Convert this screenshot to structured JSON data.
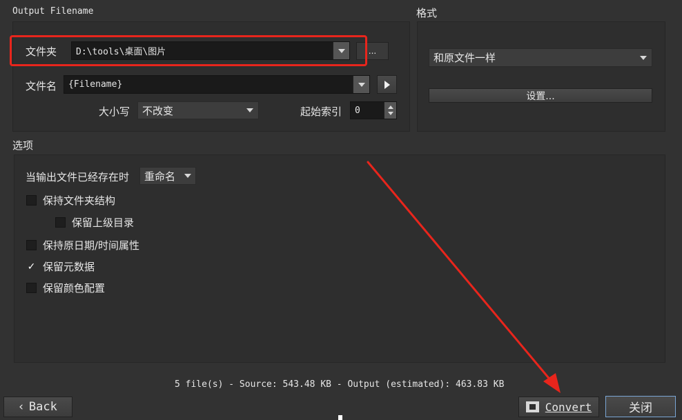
{
  "output": {
    "title": "Output Filename",
    "folder_label": "文件夹",
    "folder_value": "D:\\tools\\桌面\\图片",
    "browse_label": "...",
    "filename_label": "文件名",
    "filename_value": "{Filename}",
    "case_label": "大小写",
    "case_value": "不改变",
    "start_index_label": "起始索引",
    "start_index_value": "0"
  },
  "format": {
    "title": "格式",
    "format_value": "和原文件一样",
    "settings_label": "设置..."
  },
  "options": {
    "title": "选项",
    "exists_label": "当输出文件已经存在时",
    "exists_value": "重命名",
    "checkboxes": [
      {
        "label": "保持文件夹结构",
        "checked": false
      },
      {
        "label": "保留上级目录",
        "checked": false
      },
      {
        "label": "保持原日期/时间属性",
        "checked": false
      },
      {
        "label": "保留元数据",
        "checked": true
      },
      {
        "label": "保留颜色配置",
        "checked": false
      }
    ]
  },
  "status": {
    "text": "5 file(s) - Source: 543.48 KB - Output (estimated): 463.83 KB"
  },
  "footer": {
    "back_label": "Back",
    "convert_label": "Convert",
    "close_label": "关闭"
  },
  "colors": {
    "annotation": "#e8251c",
    "focus": "#7aa6d6"
  }
}
